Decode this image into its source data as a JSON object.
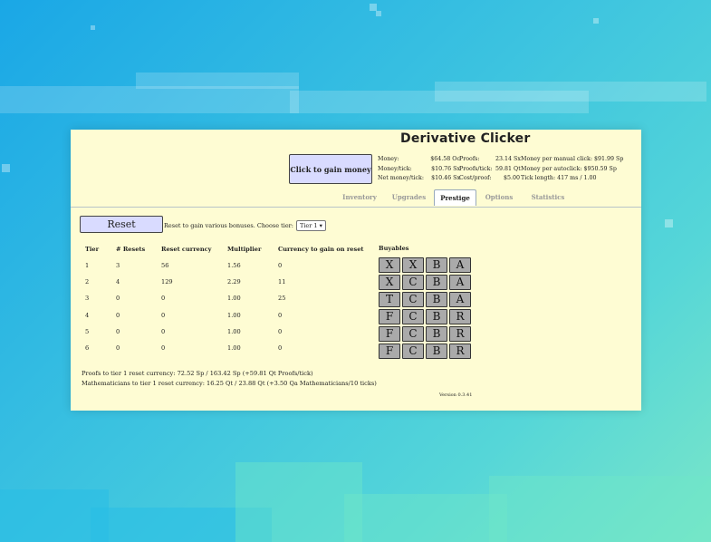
{
  "title": "Derivative Clicker",
  "click_button": "Click to gain money",
  "stats_a": [
    {
      "k": "Money:",
      "v": "$64.58 Oc"
    },
    {
      "k": "Money/tick:",
      "v": "$10.76 Sx"
    },
    {
      "k": "Net money/tick:",
      "v": "$10.46 Sx"
    }
  ],
  "stats_b": [
    {
      "k": "Proofs:",
      "v": "23.14 Sx"
    },
    {
      "k": "Proofs/tick:",
      "v": "59.81 Qt"
    },
    {
      "k": "Cost/proof:",
      "v": "$5.00"
    }
  ],
  "stats_c": [
    "Money per manual click: $91.99 Sp",
    "Money per autoclick: $950.59 Sp",
    "Tick length: 417 ms / 1.00"
  ],
  "tabs": [
    "Inventory",
    "Upgrades",
    "Prestige",
    "Options",
    "Statistics"
  ],
  "active_tab": "Prestige",
  "reset_button": "Reset",
  "reset_desc": "Reset to gain various bonuses. Choose tier:",
  "tier_select": "Tier 1 ▾",
  "table": {
    "headers": [
      "Tier",
      "# Resets",
      "Reset currency",
      "Multiplier",
      "Currency to gain on reset"
    ],
    "rows": [
      [
        "1",
        "3",
        "56",
        "1.56",
        "0"
      ],
      [
        "2",
        "4",
        "129",
        "2.29",
        "11"
      ],
      [
        "3",
        "0",
        "0",
        "1.00",
        "25"
      ],
      [
        "4",
        "0",
        "0",
        "1.00",
        "0"
      ],
      [
        "5",
        "0",
        "0",
        "1.00",
        "0"
      ],
      [
        "6",
        "0",
        "0",
        "1.00",
        "0"
      ]
    ]
  },
  "buyables_title": "Buyables",
  "buyables": [
    [
      "X",
      "X",
      "B",
      "A"
    ],
    [
      "X",
      "C",
      "B",
      "A"
    ],
    [
      "T",
      "C",
      "B",
      "A"
    ],
    [
      "F",
      "C",
      "B",
      "R"
    ],
    [
      "F",
      "C",
      "B",
      "R"
    ],
    [
      "F",
      "C",
      "B",
      "R"
    ]
  ],
  "footer": [
    "Proofs to tier 1 reset currency:           72.52 Sp / 163.42 Sp (+59.81 Qt Proofs/tick)",
    "Mathematicians to tier 1 reset currency: 16.25 Qt / 23.88 Qt (+3.50 Qa Mathematicians/10 ticks)"
  ],
  "version": "Version 0.3.41"
}
